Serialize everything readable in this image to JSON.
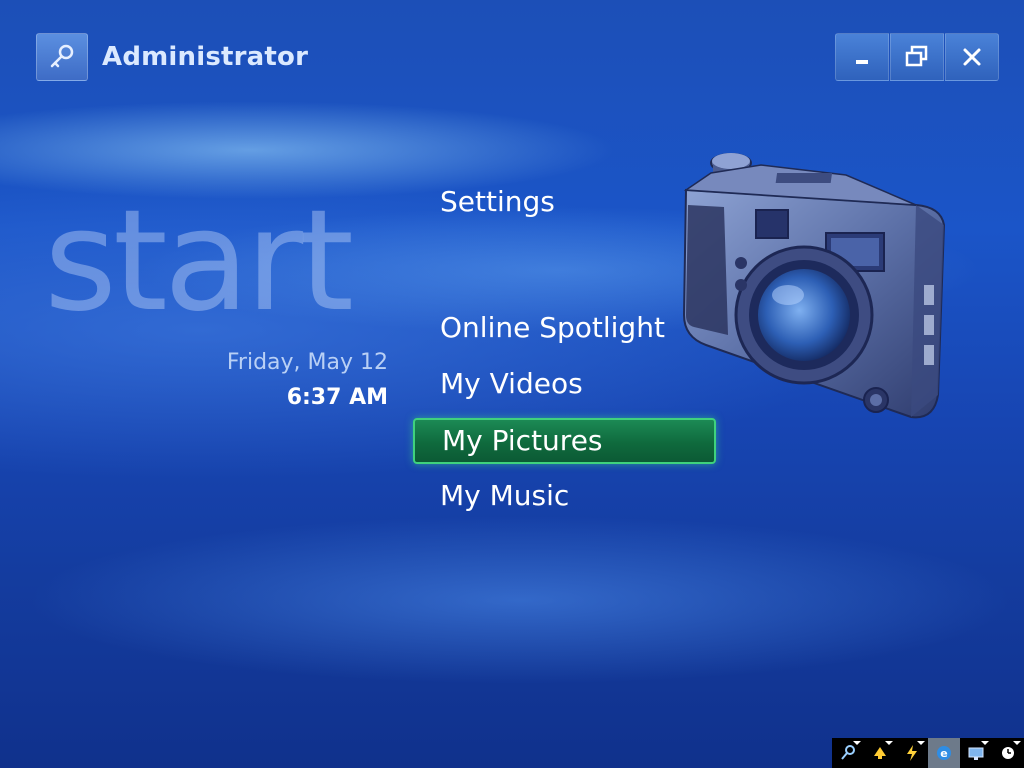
{
  "header": {
    "username": "Administrator"
  },
  "window_controls": {
    "minimize": "minimize-icon",
    "restore": "restore-icon",
    "close": "close-icon"
  },
  "start": {
    "title": "start",
    "date": "Friday, May 12",
    "time": "6:37 AM"
  },
  "menu": {
    "items": [
      {
        "label": "Settings"
      },
      {
        "label": "Online Spotlight"
      },
      {
        "label": "My Videos"
      },
      {
        "label": "My Pictures",
        "selected": true
      },
      {
        "label": "My Music"
      }
    ]
  },
  "preview": {
    "icon": "camera-icon"
  },
  "tray": {
    "icons": [
      "network-icon",
      "notification-icon",
      "power-icon",
      "internet-explorer-icon",
      "monitor-icon",
      "clock-icon"
    ]
  },
  "colors": {
    "selection": "#0f6a3d",
    "selection_border": "#3fd27d",
    "background": "#1b55c8"
  }
}
